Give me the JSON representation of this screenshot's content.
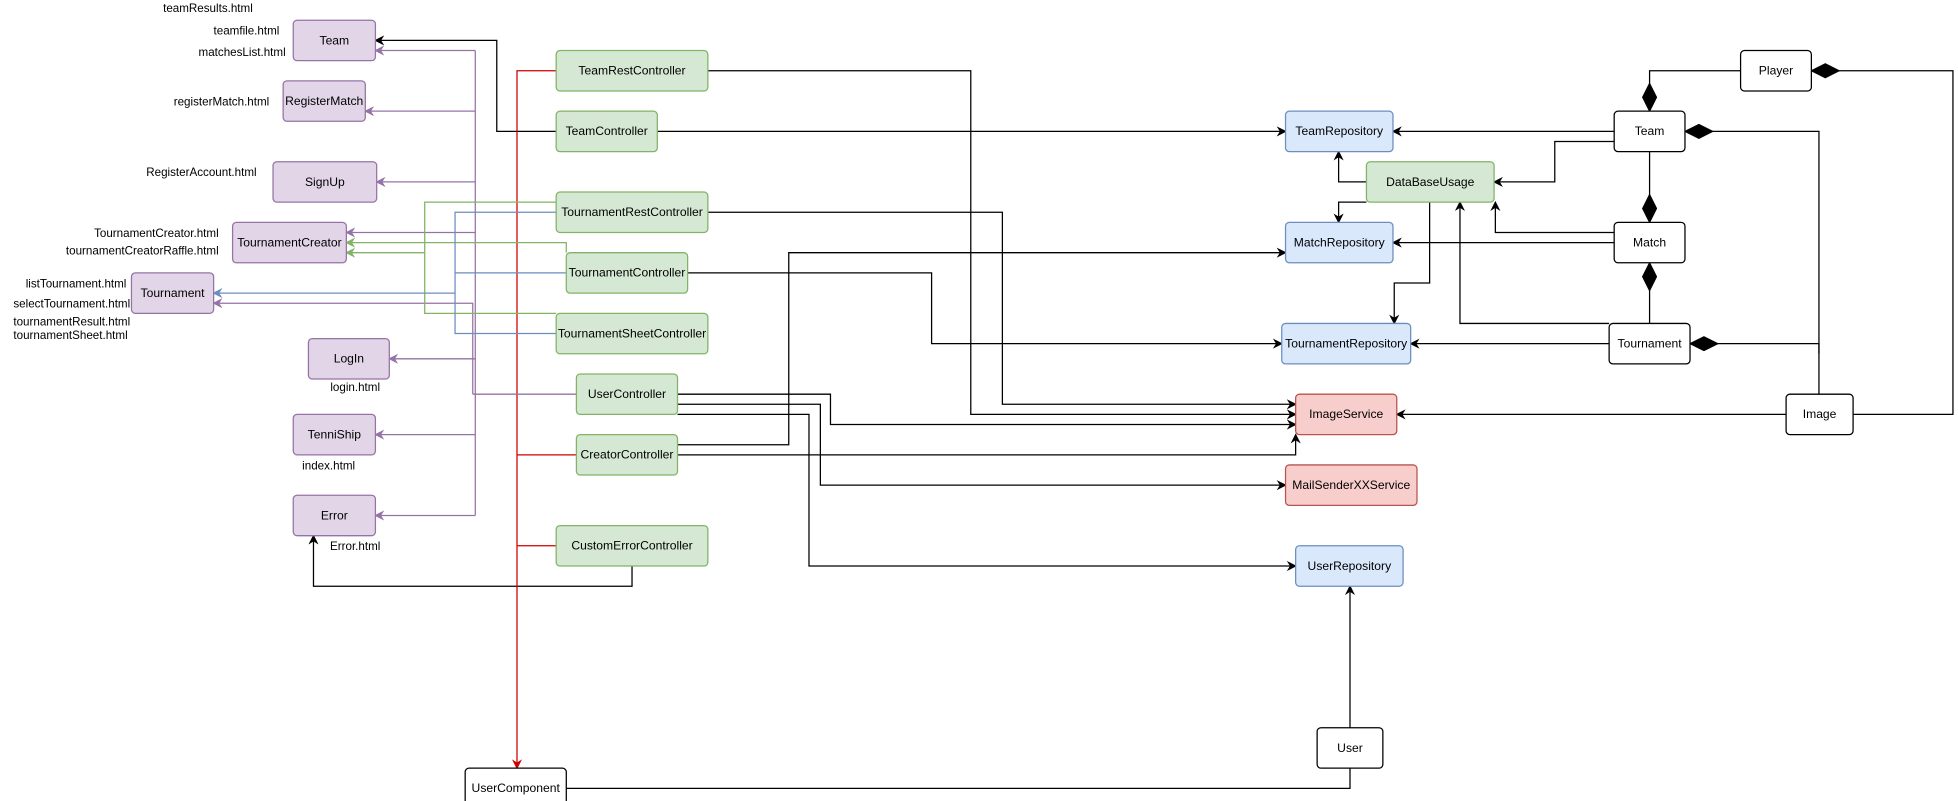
{
  "colors": {
    "view_fill": "#e1d5e7",
    "view_stroke": "#9673a6",
    "controller_fill": "#d5e8d4",
    "controller_stroke": "#82b366",
    "repository_fill": "#dae8fc",
    "repository_stroke": "#6c8ebf",
    "service_fill": "#f8cecc",
    "service_stroke": "#b85450",
    "entity_fill": "#ffffff",
    "entity_stroke": "#000000",
    "edge_red": "#cc0000",
    "edge_purple": "#9673a6",
    "edge_green": "#82b366",
    "edge_blue": "#6c8ebf"
  },
  "views": {
    "team": "Team",
    "register_match": "RegisterMatch",
    "signup": "SignUp",
    "tournament_creator": "TournamentCreator",
    "tournament": "Tournament",
    "login": "LogIn",
    "tenniship": "TenniShip",
    "error": "Error"
  },
  "files": {
    "team_results": "teamResults.html",
    "teamfile": "teamfile.html",
    "matches_list": "matchesList.html",
    "register_match": "registerMatch.html",
    "register_account": "RegisterAccount.html",
    "tournament_creator": "TournamentCreator.html",
    "tournament_creator_raffle": "tournamentCreatorRaffle.html",
    "list_tournament": "listTournament.html",
    "select_tournament": "selectTournament.html",
    "tournament_result": "tournamentResult.html",
    "tournament_sheet": "tournamentSheet.html",
    "login": "login.html",
    "index": "index.html",
    "error": "Error.html"
  },
  "controllers": {
    "team_rest": "TeamRestController",
    "team": "TeamController",
    "tournament_rest": "TournamentRestController",
    "tournament": "TournamentController",
    "tournament_sheet": "TournamentSheetController",
    "user": "UserController",
    "creator": "CreatorController",
    "custom_error": "CustomErrorController",
    "database_usage": "DataBaseUsage"
  },
  "repositories": {
    "team": "TeamRepository",
    "match": "MatchRepository",
    "tournament": "TournamentRepository",
    "user": "UserRepository"
  },
  "services": {
    "image": "ImageService",
    "mail": "MailSenderXXService"
  },
  "entities": {
    "player": "Player",
    "team": "Team",
    "match": "Match",
    "tournament": "Tournament",
    "image": "Image",
    "user": "User",
    "user_component": "UserComponent"
  }
}
